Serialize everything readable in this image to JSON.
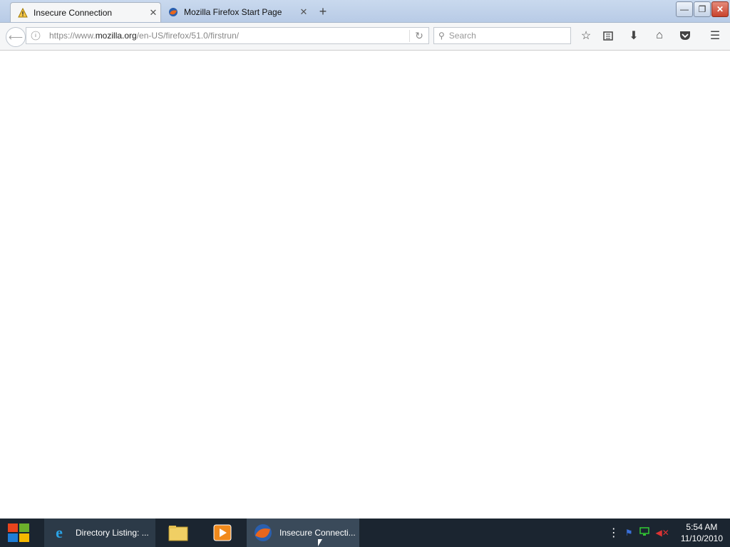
{
  "browser": {
    "tabs": [
      {
        "title": "Insecure Connection",
        "icon": "warning-icon"
      },
      {
        "title": "Mozilla Firefox Start Page",
        "icon": "firefox-icon"
      }
    ],
    "url_prefix": "https://www.",
    "url_host": "mozilla.org",
    "url_path": "/en-US/firefox/51.0/firstrun/",
    "search_placeholder": "Search"
  },
  "taskbar": {
    "buttons": [
      {
        "label": "Directory Listing: ...",
        "icon": "ie-icon"
      },
      {
        "label": "",
        "icon": "folder-icon"
      },
      {
        "label": "",
        "icon": "media-player-icon"
      },
      {
        "label": "Insecure Connecti...",
        "icon": "firefox-icon"
      }
    ],
    "time": "5:54 AM",
    "date": "11/10/2010"
  }
}
